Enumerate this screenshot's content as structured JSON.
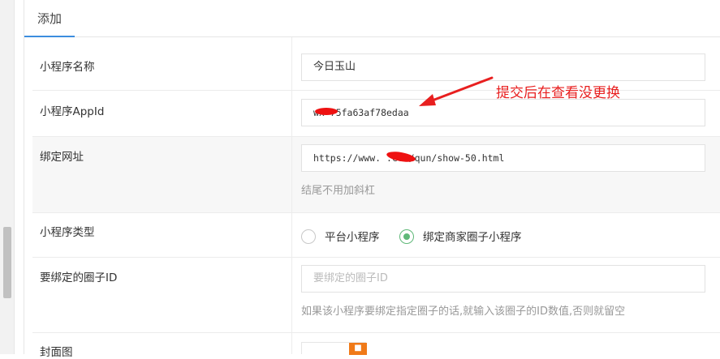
{
  "tabs": [
    {
      "label": "添加",
      "active": true
    }
  ],
  "form": {
    "name": {
      "label": "小程序名称",
      "value": "今日玉山"
    },
    "appid": {
      "label": "小程序AppId",
      "value": "wx 75fa63af78edaa"
    },
    "bind_url": {
      "label": "绑定网址",
      "value": "https://www.       .com/qun/show-50.html",
      "help": "结尾不用加斜杠"
    },
    "type": {
      "label": "小程序类型",
      "options": [
        {
          "label": "平台小程序",
          "checked": false
        },
        {
          "label": "绑定商家圈子小程序",
          "checked": true
        }
      ]
    },
    "circle_id": {
      "label": "要绑定的圈子ID",
      "placeholder": "要绑定的圈子ID",
      "help": "如果该小程序要绑定指定圈子的话,就输入该圈子的ID数值,否则就留空"
    },
    "cover": {
      "label": "封面图"
    }
  },
  "annotation": {
    "text": "提交后在查看没更换"
  },
  "colors": {
    "accent": "#3c8dde",
    "radio_checked": "#5fb878",
    "annotation": "#e81f1f",
    "redaction": "#ee1111"
  },
  "icons": {
    "cover_thumb": "image-icon"
  }
}
